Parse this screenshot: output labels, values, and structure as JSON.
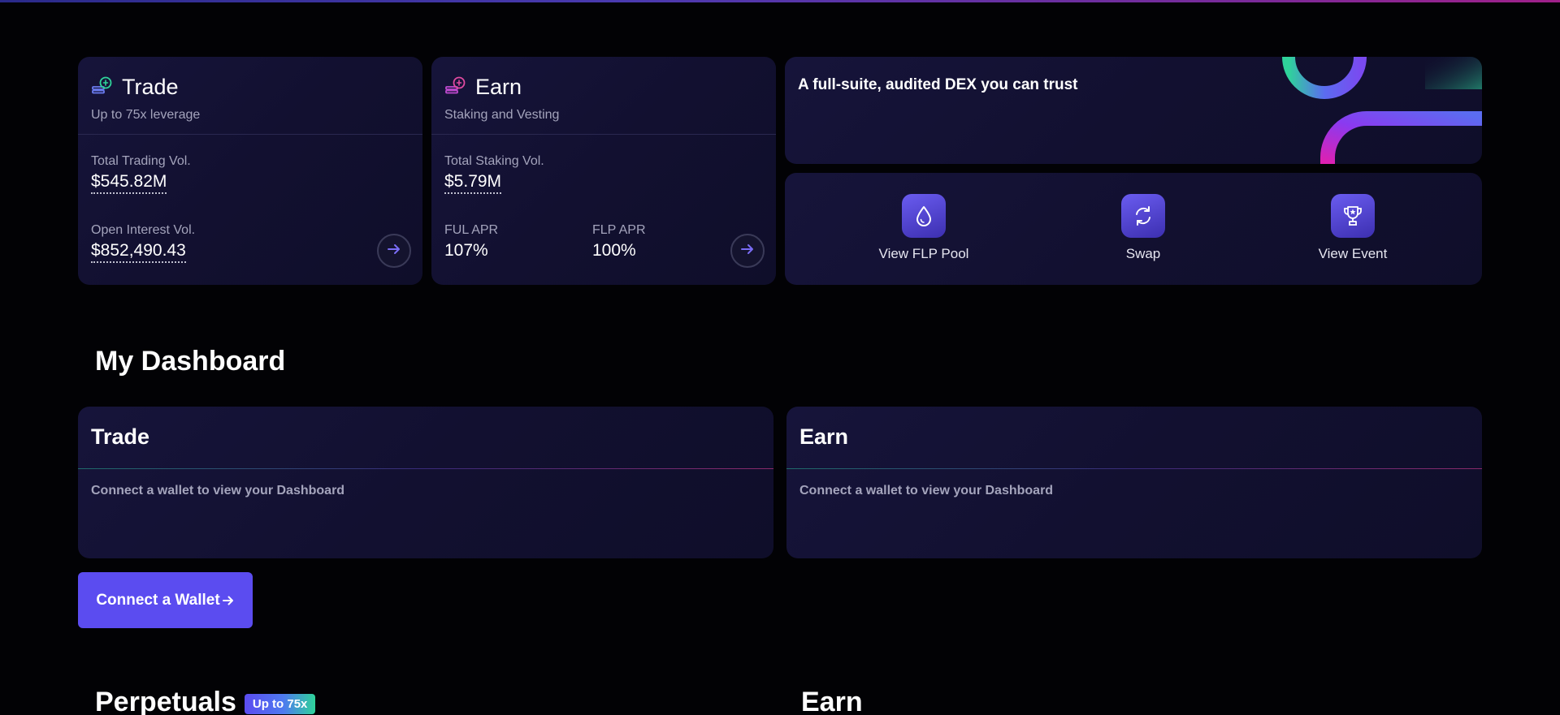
{
  "colors": {
    "accent": "#5b4cf0",
    "card_bg": "#15133a",
    "page_bg": "#020205",
    "muted_text": "#a4a4bc"
  },
  "trade_card": {
    "title": "Trade",
    "subtitle": "Up to 75x leverage",
    "icon": "trade-coins-icon",
    "stat1_label": "Total Trading Vol.",
    "stat1_value": "$545.82M",
    "stat2_label": "Open Interest Vol.",
    "stat2_value": "$852,490.43",
    "arrow_icon": "arrow-right-icon"
  },
  "earn_card": {
    "title": "Earn",
    "subtitle": "Staking and Vesting",
    "icon": "earn-coins-icon",
    "stat1_label": "Total Staking Vol.",
    "stat1_value": "$5.79M",
    "apr1_label": "FUL APR",
    "apr1_value": "107%",
    "apr2_label": "FLP APR",
    "apr2_value": "100%",
    "arrow_icon": "arrow-right-icon"
  },
  "banner": {
    "title": "A full-suite, audited DEX you can trust"
  },
  "quick_actions": [
    {
      "label": "View FLP Pool",
      "icon": "droplet-icon"
    },
    {
      "label": "Swap",
      "icon": "swap-refresh-icon"
    },
    {
      "label": "View Event",
      "icon": "trophy-icon"
    }
  ],
  "dashboard": {
    "title": "My Dashboard",
    "trade": {
      "title": "Trade",
      "message": "Connect a wallet to view your Dashboard"
    },
    "earn": {
      "title": "Earn",
      "message": "Connect a wallet to view your Dashboard"
    },
    "connect_button": "Connect a Wallet"
  },
  "bottom": {
    "perpetuals_title": "Perpetuals",
    "perpetuals_badge": "Up to 75x",
    "earn_title": "Earn"
  }
}
